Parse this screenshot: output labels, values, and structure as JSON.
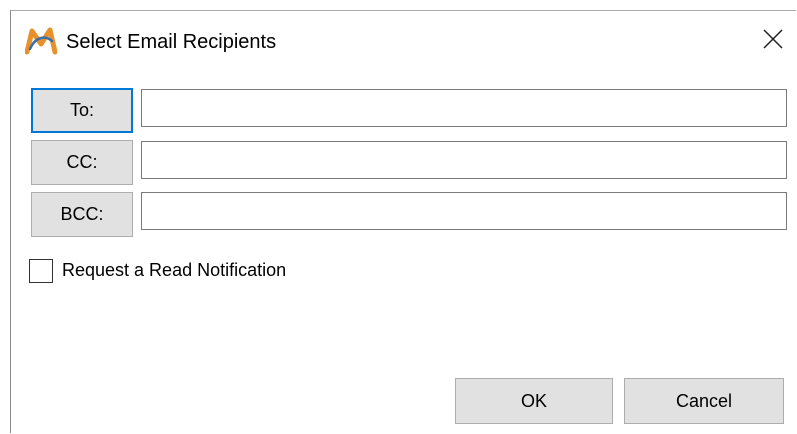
{
  "window": {
    "title": "Select Email Recipients",
    "app_icon": "m-logo-icon",
    "close_icon": "close-icon"
  },
  "recipients": {
    "to_label": "To:",
    "to_value": "",
    "cc_label": "CC:",
    "cc_value": "",
    "bcc_label": "BCC:",
    "bcc_value": ""
  },
  "options": {
    "read_notification_label": "Request a Read Notification",
    "read_notification_checked": false
  },
  "actions": {
    "ok_label": "OK",
    "cancel_label": "Cancel"
  },
  "colors": {
    "accent": "#0078d7",
    "button_face": "#e1e1e1",
    "logo_orange": "#e8912a",
    "logo_blue": "#3b6ea8"
  }
}
